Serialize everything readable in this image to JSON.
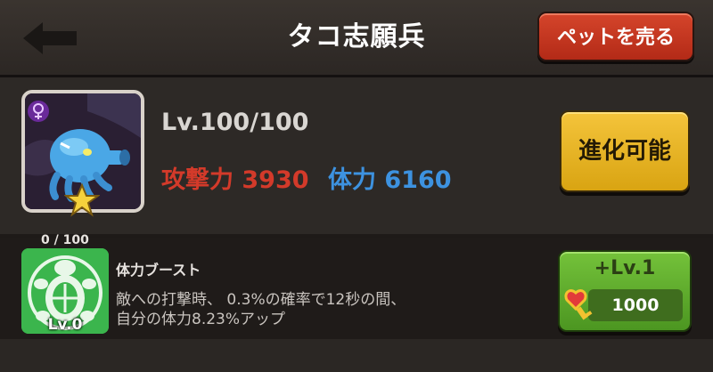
{
  "header": {
    "title": "タコ志願兵",
    "back_icon": "back-arrow-icon",
    "sell_label": "ペットを売る"
  },
  "pet": {
    "portrait_icon": "octopus-pet-portrait",
    "gender_icon": "female-symbol-icon",
    "star_icon": "star-icon",
    "level": "Lv.100/100",
    "attack": "攻撃力 3930",
    "hp": "体力 6160",
    "evolve_label": "進化可能"
  },
  "skill": {
    "count": "0 / 100",
    "icon": "turtle-shield-skill-icon",
    "level": "Lv.0",
    "name": "体力ブースト",
    "description_line1": "敵への打撃時、 0.3%の確率で12秒の間、",
    "description_line2": "自分の体力8.23%アップ",
    "levelup_label": "+Lv.1",
    "cost_icon": "heart-key-icon",
    "cost": "1000"
  },
  "colors": {
    "attack": "#d33a2a",
    "hp": "#3d92e0",
    "sell_button": "#c2361f",
    "evolve_button": "#e9b52a",
    "levelup_button": "#62ad2e"
  }
}
